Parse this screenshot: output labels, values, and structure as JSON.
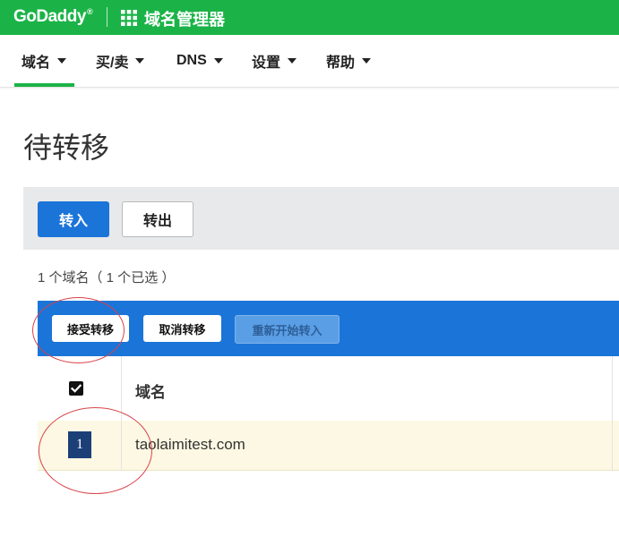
{
  "brand": {
    "logo_text": "GoDaddy",
    "registered_mark": "®",
    "app_title": "域名管理器"
  },
  "nav": {
    "items": [
      {
        "label": "域名",
        "active": true
      },
      {
        "label": "买/卖"
      },
      {
        "label": "DNS"
      },
      {
        "label": "设置"
      },
      {
        "label": "帮助"
      }
    ]
  },
  "page": {
    "title": "待转移"
  },
  "toolbar": {
    "transfer_in_label": "转入",
    "transfer_out_label": "转出"
  },
  "selection_summary": "1 个域名（ 1 个已选 ）",
  "actions": {
    "accept_label": "接受转移",
    "cancel_label": "取消转移",
    "restart_label": "重新开始转入"
  },
  "table": {
    "columns": [
      "域名"
    ],
    "header_checkbox_checked": true,
    "rows": [
      {
        "selected_badge": "1",
        "domain": "taolaimitest.com"
      }
    ]
  },
  "colors": {
    "brand_green": "#1bb347",
    "primary_blue": "#1b74d8",
    "row_highlight": "#fcf8e3",
    "annotation_red": "#d8434a"
  },
  "icons": [
    "apps-grid-icon",
    "caret-down-icon",
    "checkbox-checked-icon"
  ]
}
